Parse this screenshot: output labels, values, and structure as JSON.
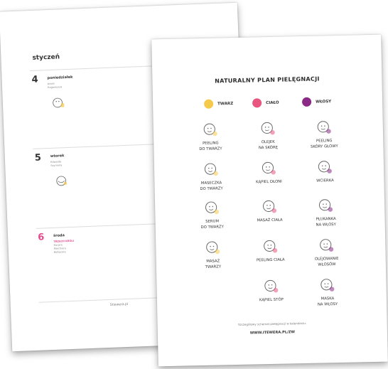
{
  "calendar": {
    "month": "styczeń",
    "days": [
      {
        "num": "4",
        "weekday": "poniedziałek",
        "names": [
          "Anieli",
          "Eugeniusza"
        ],
        "highlight": ""
      },
      {
        "num": "5",
        "weekday": "wtorek",
        "names": [
          "Edwarda",
          "Szymona"
        ],
        "highlight": ""
      },
      {
        "num": "6",
        "weekday": "środa",
        "names": [
          "Kacpra",
          "Melchiora",
          "Baltazara"
        ],
        "highlight": "TRZECH KRÓLI"
      }
    ],
    "footer_url": "Stiewera.pl"
  },
  "plan": {
    "title": "NATURALNY PLAN PIELĘGNACJI",
    "legend": [
      {
        "label": "TWARZ",
        "color": "#f5c94a"
      },
      {
        "label": "CIAŁO",
        "color": "#e8557e"
      },
      {
        "label": "WŁOSY",
        "color": "#8a2a86"
      }
    ],
    "items": [
      {
        "label1": "PEELING",
        "label2": "DO TWARZY",
        "icon": "face-peeling-icon",
        "accent": "#f5c94a"
      },
      {
        "label1": "OLEJEK",
        "label2": "NA SKÓRĘ",
        "icon": "oil-bottle-icon",
        "accent": "#e8557e"
      },
      {
        "label1": "PEELING",
        "label2": "SKÓRY GŁOWY",
        "icon": "scalp-peeling-icon",
        "accent": "#8a2a86"
      },
      {
        "label1": "MASECZKA",
        "label2": "DO TWARZY",
        "icon": "face-mask-icon",
        "accent": "#f5c94a"
      },
      {
        "label1": "KĄPIEL DŁONI",
        "label2": "",
        "icon": "hand-bath-icon",
        "accent": "#e8557e"
      },
      {
        "label1": "WCIERKA",
        "label2": "",
        "icon": "hair-tonic-icon",
        "accent": "#8a2a86"
      },
      {
        "label1": "SERUM",
        "label2": "DO TWARZY",
        "icon": "face-serum-icon",
        "accent": "#f5c94a"
      },
      {
        "label1": "MASAŻ CIAŁA",
        "label2": "",
        "icon": "body-massage-icon",
        "accent": "#e8557e"
      },
      {
        "label1": "PŁUKANKA",
        "label2": "NA WŁOSY",
        "icon": "hair-rinse-icon",
        "accent": "#8a2a86"
      },
      {
        "label1": "MASAŻ",
        "label2": "TWARZY",
        "icon": "face-massage-icon",
        "accent": "#f5c94a"
      },
      {
        "label1": "PEELING CIAŁA",
        "label2": "",
        "icon": "body-peeling-icon",
        "accent": "#e8557e"
      },
      {
        "label1": "OLEJOWANIE",
        "label2": "WŁOSÓW",
        "icon": "hair-oiling-icon",
        "accent": "#8a2a86"
      },
      {
        "label1": "KĄPIEL STÓP",
        "label2": "",
        "icon": "foot-bath-icon",
        "accent": "#e8557e"
      },
      {
        "label1": "MASKA",
        "label2": "NA WŁOSY",
        "icon": "hair-mask-icon",
        "accent": "#8a2a86"
      }
    ],
    "note": "Szczegółowy schemat pielęgnacji w kalendarzu.",
    "link": "WWW.ITEWERA.PL/ZW"
  }
}
